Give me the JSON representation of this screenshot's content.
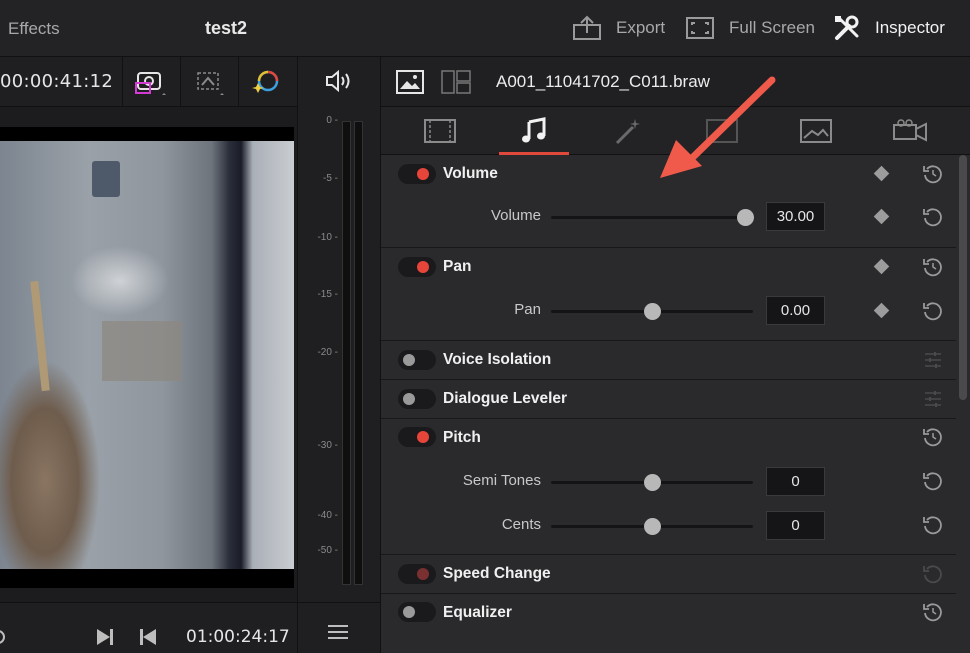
{
  "topbar": {
    "effects_label": "Effects",
    "project_name": "test2",
    "export_label": "Export",
    "fullscreen_label": "Full Screen",
    "inspector_label": "Inspector"
  },
  "viewer": {
    "timecode": "00:00:41:12",
    "transport_timecode": "01:00:24:17"
  },
  "meter": {
    "scale": [
      "0",
      "-5",
      "-10",
      "-15",
      "-20",
      "-30",
      "-40",
      "-50"
    ]
  },
  "inspector": {
    "clip_name": "A001_11041702_C011.braw",
    "tabs": [
      {
        "icon": "video-tab-icon"
      },
      {
        "icon": "audio-tab-icon",
        "active": true
      },
      {
        "icon": "effects-tab-icon"
      },
      {
        "icon": "transition-tab-icon"
      },
      {
        "icon": "image-tab-icon"
      },
      {
        "icon": "file-tab-icon"
      }
    ],
    "sections": {
      "volume": {
        "title": "Volume",
        "param_label": "Volume",
        "value": "30.00",
        "slider_fraction": 0.96
      },
      "pan": {
        "title": "Pan",
        "param_label": "Pan",
        "value": "0.00",
        "slider_fraction": 0.5
      },
      "voice_isolation": {
        "title": "Voice Isolation"
      },
      "dialogue_leveler": {
        "title": "Dialogue Leveler"
      },
      "pitch": {
        "title": "Pitch",
        "semi_tones_label": "Semi Tones",
        "semi_tones_value": "0",
        "semi_tones_fraction": 0.5,
        "cents_label": "Cents",
        "cents_value": "0",
        "cents_fraction": 0.5
      },
      "speed_change": {
        "title": "Speed Change"
      },
      "equalizer": {
        "title": "Equalizer"
      }
    }
  },
  "colors": {
    "accent_red": "#e8453a",
    "annotation_arrow": "#f05a4a"
  }
}
